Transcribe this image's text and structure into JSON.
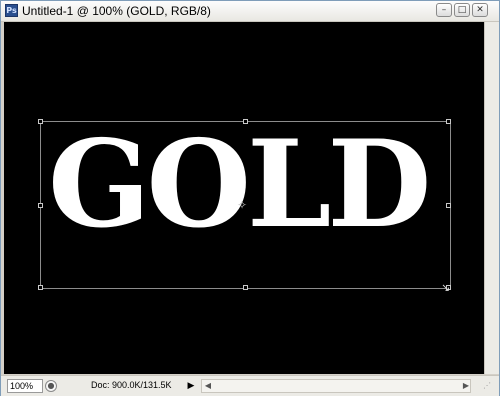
{
  "window": {
    "title": "Untitled-1 @ 100% (GOLD, RGB/8)",
    "controls": {
      "minimize": "–",
      "restore": "□",
      "close": "✕"
    },
    "icons": {
      "app": "photoshop-document-icon"
    }
  },
  "canvas": {
    "text": "GOLD",
    "background": "#000000",
    "text_color": "#ffffff",
    "selection": "transform-bounding-box",
    "center_marker": "✧",
    "cursor_icon": "↘"
  },
  "status": {
    "zoom": "100%",
    "doc": "Doc: 900.0K/131.5K",
    "menu_arrow": "▶",
    "scroll_left": "◀",
    "scroll_right": "▶",
    "grip": "⋰",
    "info_icon": "●"
  }
}
